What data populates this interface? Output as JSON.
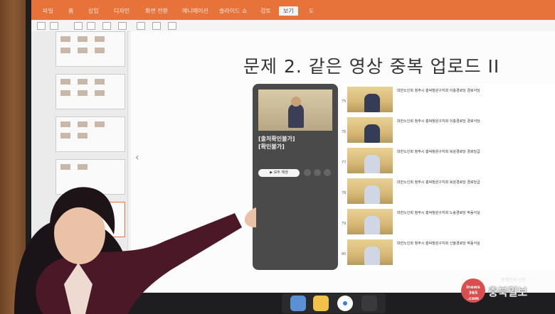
{
  "ribbon": {
    "tabs": [
      "파일",
      "홈",
      "삽입",
      "디자인",
      "화면 전환",
      "애니메이션",
      "슬라이드 쇼",
      "검토",
      "보기",
      "도"
    ],
    "active_index": 8,
    "color": "#e8733a"
  },
  "slide": {
    "title": "문제 2. 같은 영상 중복 업로드 II",
    "phone": {
      "title": "[출처확인불가]\n[확인불가]",
      "button": "▶ 모두 재생"
    },
    "rows": [
      {
        "num": "75",
        "title": "대한노인회 청주시 흥덕청원구지회 이충경로당 경로식당"
      },
      {
        "num": "76",
        "title": "대한노인회 청주시 흥덕청원구지회 이충경로당 경로식당"
      },
      {
        "num": "77",
        "title": "대한노인회 청주시 흥덕청원구지회 북삼경로당 경로당급"
      },
      {
        "num": "78",
        "title": "대한노인회 청주시 흥덕청원구지회 북삼경로당 경로당급"
      },
      {
        "num": "79",
        "title": "대한노인회 청주시 흥덕청원구지회 노송경로당 박동식실"
      },
      {
        "num": "80",
        "title": "대한노인회 청주시 흥덕청원구지회 신율경로당 박동식실"
      }
    ]
  },
  "watermark": {
    "circle": "inews\n365\n.com",
    "name": "충북일보",
    "tagline": "충북인의 신문"
  }
}
